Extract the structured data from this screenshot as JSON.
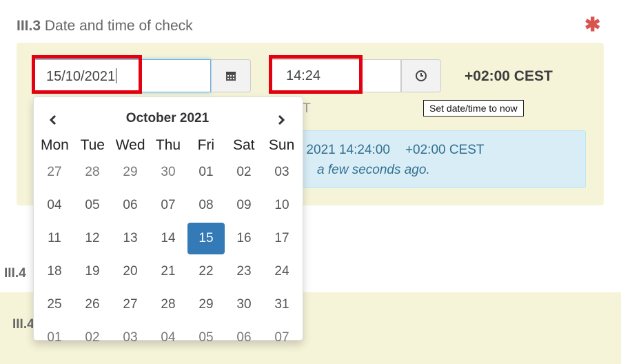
{
  "section": {
    "number": "III.3",
    "title": "Date and time of check",
    "required_mark": "✱"
  },
  "date_input": {
    "value": "15/10/2021"
  },
  "time_input": {
    "value": "14:24"
  },
  "timezone_label": "+02:00 CEST",
  "timezone_small": "CEST",
  "tooltip": "Set date/time to now",
  "summary": {
    "datetime": "ber 15, 2021 14:24:00",
    "timezone": "+02:00 CEST",
    "relative": "a few seconds ago."
  },
  "calendar": {
    "title": "October 2021",
    "weekdays": [
      "Mon",
      "Tue",
      "Wed",
      "Thu",
      "Fri",
      "Sat",
      "Sun"
    ],
    "weeks": [
      [
        "27",
        "28",
        "29",
        "30",
        "01",
        "02",
        "03"
      ],
      [
        "04",
        "05",
        "06",
        "07",
        "08",
        "09",
        "10"
      ],
      [
        "11",
        "12",
        "13",
        "14",
        "15",
        "16",
        "17"
      ],
      [
        "18",
        "19",
        "20",
        "21",
        "22",
        "23",
        "24"
      ],
      [
        "25",
        "26",
        "27",
        "28",
        "29",
        "30",
        "31"
      ],
      [
        "01",
        "02",
        "03",
        "04",
        "05",
        "06",
        "07"
      ]
    ],
    "selected": {
      "week": 2,
      "day": 4
    }
  },
  "next_section": {
    "label_a": "III.4",
    "label_b": "III.4"
  },
  "colors": {
    "highlight": "#e3000f",
    "selected_day": "#337ab7",
    "panel": "#f6f4d8",
    "info": "#d9edf7"
  },
  "icons": {
    "calendar": "calendar-icon",
    "clock": "clock-icon",
    "prev": "chevron-left-icon",
    "next": "chevron-right-icon",
    "required": "asterisk-icon"
  }
}
